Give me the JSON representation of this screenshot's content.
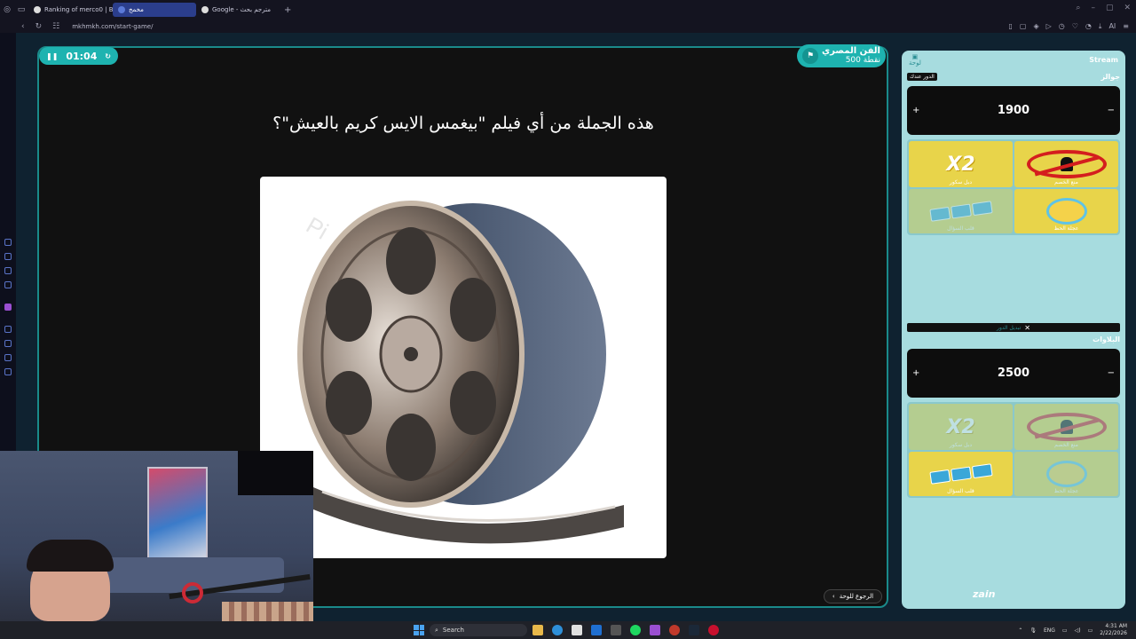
{
  "browser": {
    "tabs": [
      {
        "label": "Ranking of merco0 | Botfl",
        "active": false
      },
      {
        "label": "مخمخ",
        "active": true
      },
      {
        "label": "Google - مترجم بحث",
        "active": false
      }
    ],
    "url": "mkhmkh.com/start-game/",
    "ai_label": "AI"
  },
  "game": {
    "timer": "01:04",
    "category": "الفن المصري",
    "points": "500 نقطة",
    "question": "هذه الجملة من أي فيلم \"بيغمس الايس كريم بالعيش\"؟",
    "back_button": "الرجوع للوحة",
    "image_icon": "film-reel-icon"
  },
  "panel": {
    "stream_label": "Stream",
    "board_icon_label": "لوحة",
    "team1": {
      "name": "جوالز",
      "turn_badge": "الدور عندك",
      "score": "1900",
      "powerups": [
        {
          "caption": "دبل سكور",
          "icon": "x2-icon",
          "dim": false
        },
        {
          "caption": "منع الخصم",
          "icon": "no-player-icon",
          "dim": false
        },
        {
          "caption": "قلب السؤال",
          "icon": "cards-icon",
          "dim": true
        },
        {
          "caption": "عجلة الحظ",
          "icon": "wheel-icon",
          "dim": false
        }
      ]
    },
    "swap_label": "تبديل الدور",
    "team2": {
      "name": "البلاوات",
      "score": "2500",
      "powerups": [
        {
          "caption": "دبل سكور",
          "icon": "x2-icon",
          "dim": true
        },
        {
          "caption": "منع الخصم",
          "icon": "no-player-icon",
          "dim": true
        },
        {
          "caption": "قلب السؤال",
          "icon": "cards-icon",
          "dim": false
        },
        {
          "caption": "عجلة الحظ",
          "icon": "wheel-icon",
          "dim": true
        }
      ]
    },
    "sponsor": "zain"
  },
  "taskbar": {
    "search_placeholder": "Search",
    "language": "ENG",
    "time": "4:31 AM",
    "date": "2/22/2026"
  },
  "colors": {
    "accent": "#1eb3b0",
    "panel": "#a7dcdf",
    "stage": "#111111"
  }
}
